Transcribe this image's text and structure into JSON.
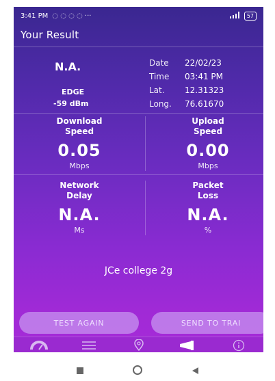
{
  "status_bar": {
    "time": "3:41 PM",
    "icons": "◌ ◌ ◌ ◌ ···",
    "signal": "4G",
    "battery": "57"
  },
  "header": {
    "title": "Your Result"
  },
  "result": {
    "status": "N.A.",
    "network_type": "EDGE",
    "signal_strength": "-59 dBm",
    "info": [
      {
        "label": "Date",
        "value": "22/02/23"
      },
      {
        "label": "Time",
        "value": "03:41 PM"
      },
      {
        "label": "Lat.",
        "value": "12.31323"
      },
      {
        "label": "Long.",
        "value": "76.61670"
      }
    ]
  },
  "metrics": {
    "download": {
      "title_line1": "Download",
      "title_line2": "Speed",
      "value": "0.05",
      "unit": "Mbps"
    },
    "upload": {
      "title_line1": "Upload",
      "title_line2": "Speed",
      "value": "0.00",
      "unit": "Mbps"
    },
    "delay": {
      "title_line1": "Network",
      "title_line2": "Delay",
      "value": "N.A.",
      "unit": "Ms"
    },
    "loss": {
      "title_line1": "Packet",
      "title_line2": "Loss",
      "value": "N.A.",
      "unit": "%"
    }
  },
  "network_name": "JCe college 2g",
  "buttons": {
    "test_again": "TEST AGAIN",
    "send_to_trai": "SEND TO TRAI"
  },
  "bottom_nav": [
    "speedometer-icon",
    "list-icon",
    "location-icon",
    "megaphone-icon",
    "info-icon"
  ],
  "colors": {
    "bg_top": "#3a2790",
    "bg_bottom": "#a62bd8",
    "button": "#c48cee"
  }
}
